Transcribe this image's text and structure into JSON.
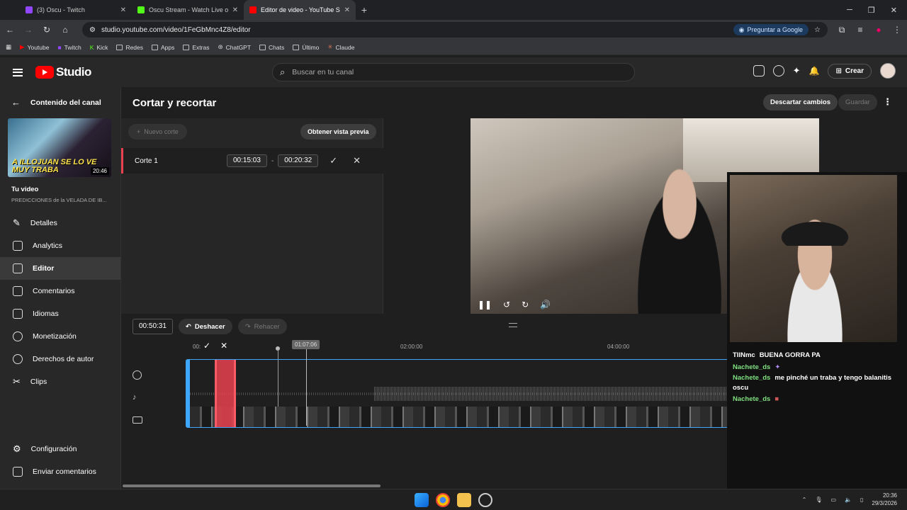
{
  "browser": {
    "tabs": [
      {
        "title": "(3) Oscu - Twitch",
        "color": "#9146ff"
      },
      {
        "title": "Oscu Stream - Watch Live on Ki",
        "color": "#53fc18"
      },
      {
        "title": "Editor de video - YouTube S",
        "color": "#ff0000"
      }
    ],
    "url": "studio.youtube.com/video/1FeGbMnc4Z8/editor",
    "google_button": "Preguntar a Google",
    "bookmarks": [
      "Youtube",
      "Twitch",
      "Kick",
      "Redes",
      "Apps",
      "Extras",
      "ChatGPT",
      "Chats",
      "Último",
      "Claude"
    ]
  },
  "header": {
    "logo_text": "Studio",
    "search_placeholder": "Buscar en tu canal",
    "create_label": "Crear"
  },
  "sidebar": {
    "back_label": "Contenido del canal",
    "thumb_caption": "A ILLOJUAN SE LO VE MUY TRABA",
    "thumb_duration": "20:46",
    "your_video": "Tu video",
    "video_title": "PREDICCIONES de la VELADA DE IB...",
    "items": [
      {
        "label": "Detalles",
        "icon": "pencil-icon"
      },
      {
        "label": "Analytics",
        "icon": "analytics-icon"
      },
      {
        "label": "Editor",
        "icon": "editor-icon"
      },
      {
        "label": "Comentarios",
        "icon": "comments-icon"
      },
      {
        "label": "Idiomas",
        "icon": "languages-icon"
      },
      {
        "label": "Monetización",
        "icon": "monetization-icon"
      },
      {
        "label": "Derechos de autor",
        "icon": "copyright-icon"
      },
      {
        "label": "Clips",
        "icon": "scissors-icon"
      }
    ],
    "bottom": [
      {
        "label": "Configuración",
        "icon": "gear-icon"
      },
      {
        "label": "Enviar comentarios",
        "icon": "feedback-icon"
      }
    ]
  },
  "editor": {
    "title": "Cortar y recortar",
    "discard": "Descartar cambios",
    "save": "Guardar",
    "new_cut": "Nuevo corte",
    "preview": "Obtener vista previa",
    "cut": {
      "label": "Corte 1",
      "start": "00:15:03",
      "end": "00:20:32"
    },
    "timecode": "00:50:31",
    "undo": "Deshacer",
    "redo": "Rehacer",
    "ruler": [
      "00:",
      "01:07:06",
      "02:00:00",
      "04:00:00"
    ],
    "playhead": "01:07:06"
  },
  "overlay_chat": [
    {
      "user": "TIINmc",
      "msg": "BUENA GORRA PA"
    },
    {
      "user": "Nachete_ds",
      "msg": ""
    },
    {
      "user": "Nachete_ds",
      "msg": "me pinché un traba y tengo balanitis oscu"
    },
    {
      "user": "Nachete_ds",
      "msg": ""
    }
  ],
  "taskbar": {
    "time": "20:36",
    "date": "29/3/2026"
  }
}
